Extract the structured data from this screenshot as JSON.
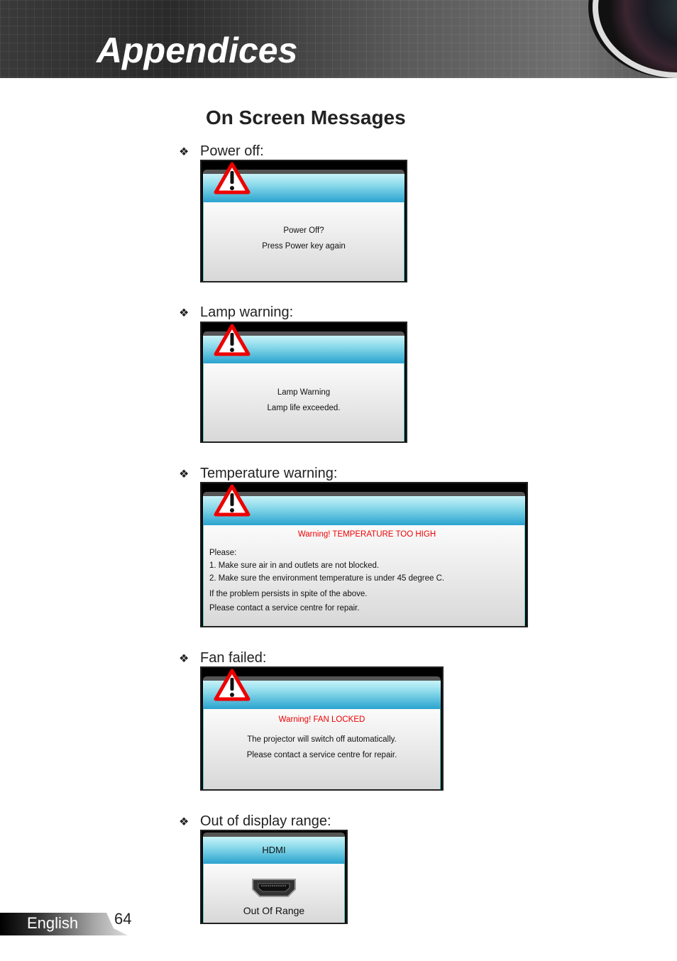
{
  "header": {
    "title": "Appendices"
  },
  "section_title": "On Screen Messages",
  "bullet_icon": "four-diamond-bullet",
  "items": [
    {
      "label": "Power off:",
      "lines": [
        "Power Off?",
        "Press Power key again"
      ]
    },
    {
      "label": "Lamp warning:",
      "lines": [
        "Lamp Warning",
        "Lamp life exceeded."
      ]
    },
    {
      "label": "Temperature warning:",
      "warning": "Warning! TEMPERATURE TOO HIGH",
      "lines": [
        "Please:",
        "1. Make sure air in and outlets are not blocked.",
        "2. Make sure the environment temperature is under 45 degree C.",
        "If the problem persists in spite of the above.",
        "Please contact a service centre for repair."
      ]
    },
    {
      "label": "Fan failed:",
      "warning": "Warning! FAN LOCKED",
      "lines": [
        "The projector will switch off automatically.",
        "Please contact a service centre for repair."
      ]
    },
    {
      "label": "Out of display range:",
      "header": "HDMI",
      "lines": [
        "Out Of Range"
      ]
    }
  ],
  "colors": {
    "warning_text": "#e00000",
    "header_cyan": "#2aa3cf"
  },
  "footer": {
    "language": "English",
    "page": "64"
  }
}
